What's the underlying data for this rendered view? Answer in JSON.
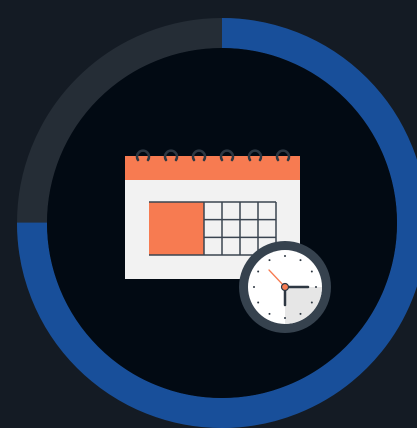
{
  "progress_ring": {
    "fraction": 0.75,
    "track_color": "#252d36",
    "fill_color": "#184f9a"
  },
  "colors": {
    "background": "#141b24",
    "inner_disc": "#020a13",
    "calendar_header": "#f77b51",
    "calendar_body": "#f2f2f2",
    "calendar_highlight": "#f77b51",
    "grid_line": "#3a4450",
    "clock_rim": "#36424e",
    "clock_face": "#ffffff",
    "clock_shade": "#e6e6e6",
    "clock_hand": "#2d3742",
    "clock_second_hand": "#f77b51"
  },
  "icons": {
    "calendar": "calendar-icon",
    "clock": "clock-icon"
  },
  "calendar": {
    "ring_count": 6,
    "grid_columns": 4,
    "grid_rows": 3
  }
}
